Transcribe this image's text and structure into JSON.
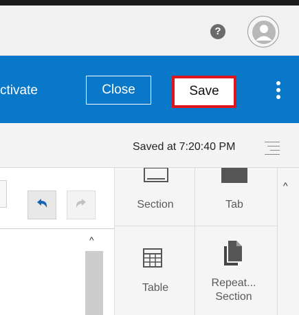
{
  "header": {
    "help_label": "?"
  },
  "toolbar": {
    "activate_label": "ctivate",
    "close_label": "Close",
    "save_label": "Save"
  },
  "status": {
    "saved_text": "Saved at 7:20:40 PM"
  },
  "palette": {
    "items": [
      {
        "label": "Section",
        "icon": "section-icon"
      },
      {
        "label": "Tab",
        "icon": "tab-icon"
      },
      {
        "label": "Table",
        "icon": "table-icon"
      },
      {
        "label_line1": "Repeat...",
        "label_line2": "Section",
        "icon": "repeat-section-icon"
      }
    ]
  },
  "colors": {
    "accent": "#0a78c9",
    "save_highlight": "#e0141b"
  }
}
